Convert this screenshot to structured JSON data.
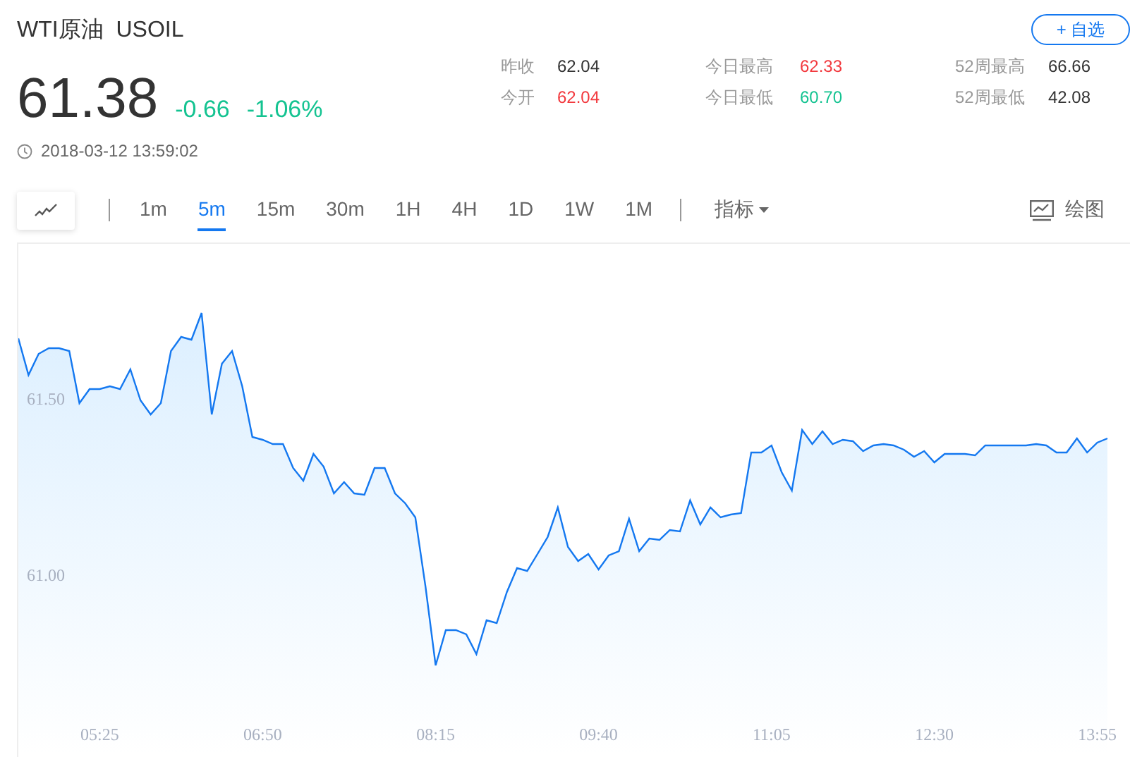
{
  "header": {
    "name": "WTI原油",
    "symbol": "USOIL",
    "watch_button": "+ 自选"
  },
  "quote": {
    "price": "61.38",
    "change": "-0.66",
    "change_pct": "-1.06%",
    "color": "#14c391",
    "timestamp": "2018-03-12 13:59:02"
  },
  "stats": [
    {
      "label": "昨收",
      "value": "62.04",
      "color": "#333333"
    },
    {
      "label": "今开",
      "value": "62.04",
      "color": "#f2383d"
    },
    {
      "label": "今日最高",
      "value": "62.33",
      "color": "#f2383d"
    },
    {
      "label": "今日最低",
      "value": "60.70",
      "color": "#14c391"
    },
    {
      "label": "52周最高",
      "value": "66.66",
      "color": "#333333"
    },
    {
      "label": "52周最低",
      "value": "42.08",
      "color": "#333333"
    }
  ],
  "toolbar": {
    "periods": [
      {
        "label": "1m",
        "selected": false
      },
      {
        "label": "5m",
        "selected": true
      },
      {
        "label": "15m",
        "selected": false
      },
      {
        "label": "30m",
        "selected": false
      },
      {
        "label": "1H",
        "selected": false
      },
      {
        "label": "4H",
        "selected": false
      },
      {
        "label": "1D",
        "selected": false
      },
      {
        "label": "1W",
        "selected": false
      },
      {
        "label": "1M",
        "selected": false
      }
    ],
    "indicator": "指标",
    "draw": "绘图"
  },
  "chart": {
    "chart_data": {
      "type": "area",
      "ylim": [
        60.492,
        61.94
      ],
      "yticks": [
        {
          "value": 61,
          "label": "61.00"
        },
        {
          "value": 61.5,
          "label": "61.50"
        }
      ],
      "categories": [
        null,
        null,
        null,
        null,
        null,
        null,
        null,
        null,
        "05:25",
        null,
        null,
        null,
        null,
        null,
        null,
        null,
        null,
        null,
        null,
        null,
        null,
        null,
        null,
        null,
        "06:50",
        null,
        null,
        null,
        null,
        null,
        null,
        null,
        null,
        null,
        null,
        null,
        null,
        null,
        null,
        null,
        null,
        "08:15",
        null,
        null,
        null,
        null,
        null,
        null,
        null,
        null,
        null,
        null,
        null,
        null,
        null,
        null,
        null,
        "09:40",
        null,
        null,
        null,
        null,
        null,
        null,
        null,
        null,
        null,
        null,
        null,
        null,
        null,
        null,
        null,
        null,
        "11:05",
        null,
        null,
        null,
        null,
        null,
        null,
        null,
        null,
        null,
        null,
        null,
        null,
        null,
        null,
        null,
        "12:30",
        null,
        null,
        null,
        null,
        null,
        null,
        null,
        null,
        null,
        null,
        null,
        null,
        null,
        null,
        null,
        "13:55",
        null
      ],
      "values": [
        61.672,
        61.568,
        61.628,
        61.644,
        61.644,
        61.636,
        61.488,
        61.528,
        61.528,
        61.536,
        61.528,
        61.584,
        61.496,
        61.456,
        61.488,
        61.636,
        61.676,
        61.668,
        61.744,
        61.456,
        61.6,
        61.636,
        61.536,
        61.392,
        61.384,
        61.372,
        61.372,
        61.304,
        61.268,
        61.344,
        61.308,
        61.232,
        61.264,
        61.232,
        61.228,
        61.304,
        61.304,
        61.232,
        61.204,
        61.164,
        60.968,
        60.744,
        60.844,
        60.844,
        60.832,
        60.776,
        60.872,
        60.864,
        60.952,
        61.02,
        61.012,
        61.06,
        61.108,
        61.192,
        61.08,
        61.04,
        61.06,
        61.016,
        61.056,
        61.068,
        61.16,
        61.068,
        61.104,
        61.1,
        61.128,
        61.124,
        61.212,
        61.144,
        61.192,
        61.164,
        61.172,
        61.176,
        61.348,
        61.348,
        61.368,
        61.292,
        61.24,
        61.412,
        61.372,
        61.408,
        61.372,
        61.384,
        61.38,
        61.352,
        61.368,
        61.372,
        61.368,
        61.356,
        61.336,
        61.352,
        61.32,
        61.344,
        61.344,
        61.344,
        61.34,
        61.368,
        61.368,
        61.368,
        61.368,
        61.368,
        61.372,
        61.368,
        61.348,
        61.348,
        61.388,
        61.348,
        61.376,
        61.388
      ]
    }
  }
}
